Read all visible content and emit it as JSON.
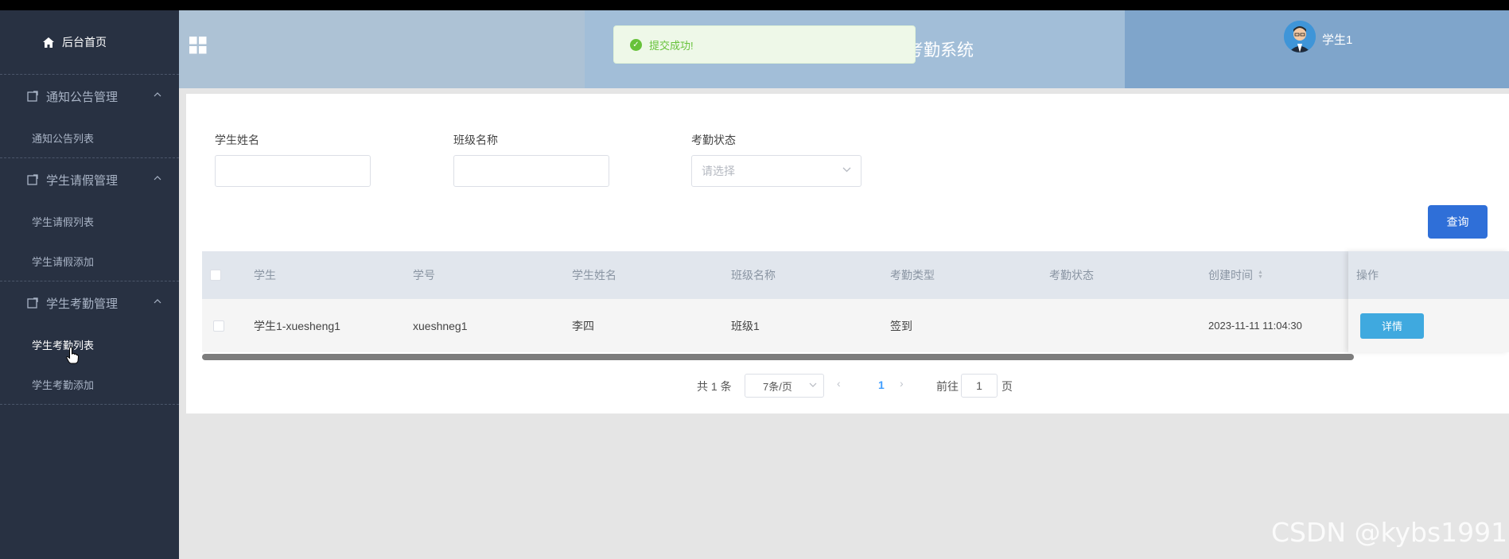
{
  "sidebar": {
    "home_label": "后台首页",
    "groups": [
      {
        "title": "通知公告管理",
        "items": [
          "通知公告列表"
        ]
      },
      {
        "title": "学生请假管理",
        "items": [
          "学生请假列表",
          "学生请假添加"
        ]
      },
      {
        "title": "学生考勤管理",
        "items": [
          "学生考勤列表",
          "学生考勤添加"
        ]
      }
    ]
  },
  "header": {
    "system_title": "考勤系统",
    "user_name": "学生1"
  },
  "toast": {
    "message": "提交成功!"
  },
  "filters": {
    "student_name_label": "学生姓名",
    "class_name_label": "班级名称",
    "status_label": "考勤状态",
    "status_placeholder": "请选择",
    "query_button": "查询"
  },
  "table": {
    "columns": [
      "学生",
      "学号",
      "学生姓名",
      "班级名称",
      "考勤类型",
      "考勤状态",
      "创建时间",
      "操作"
    ],
    "rows": [
      {
        "student": "学生1-xuesheng1",
        "student_no": "xueshneg1",
        "student_name": "李四",
        "class_name": "班级1",
        "attendance_type": "签到",
        "attendance_status": "",
        "created_at": "2023-11-11 11:04:30",
        "action": "详情"
      }
    ]
  },
  "pagination": {
    "total": "共 1 条",
    "page_size": "7条/页",
    "current_page": "1",
    "goto_label": "前往",
    "goto_value": "1",
    "page_unit": "页"
  },
  "watermark": "CSDN @kybs1991"
}
